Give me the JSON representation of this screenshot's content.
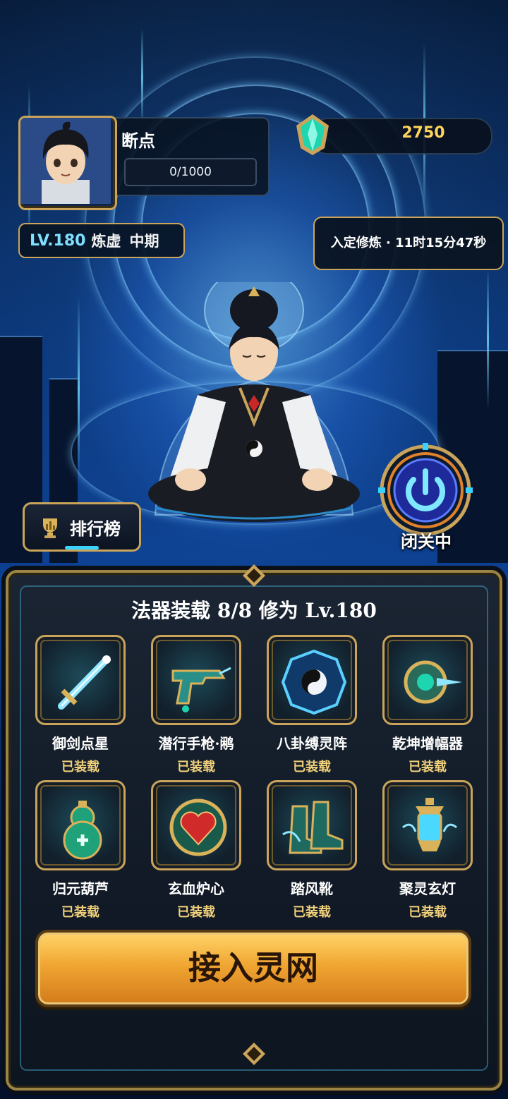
{
  "player": {
    "name": "断点",
    "exp": "0/1000",
    "level": "LV.180",
    "realm": "炼虚",
    "stage": "中期"
  },
  "currency": {
    "gems": "2750"
  },
  "status": {
    "text": "入定修炼 · 11时15分47秒"
  },
  "buttons": {
    "ranking": "排行榜",
    "retreat": "闭关中",
    "connect": "接入灵网"
  },
  "equipment": {
    "title": "法器装载 8/8 修为 Lv.180",
    "items": [
      {
        "name": "御剑点星",
        "status": "已装载",
        "icon": "sword-icon"
      },
      {
        "name": "潜行手枪·鹇",
        "status": "已装载",
        "icon": "pistol-icon"
      },
      {
        "name": "八卦缚灵阵",
        "status": "已装载",
        "icon": "bagua-icon"
      },
      {
        "name": "乾坤增幅器",
        "status": "已装载",
        "icon": "amplifier-icon"
      },
      {
        "name": "归元葫芦",
        "status": "已装载",
        "icon": "gourd-icon"
      },
      {
        "name": "玄血炉心",
        "status": "已装载",
        "icon": "heart-core-icon"
      },
      {
        "name": "踏风靴",
        "status": "已装载",
        "icon": "boots-icon"
      },
      {
        "name": "聚灵玄灯",
        "status": "已装载",
        "icon": "lantern-icon"
      }
    ]
  },
  "colors": {
    "gold": "#c9a45a",
    "cyan": "#39d2ff",
    "currency": "#ffd45c",
    "button": "#f0a632"
  }
}
